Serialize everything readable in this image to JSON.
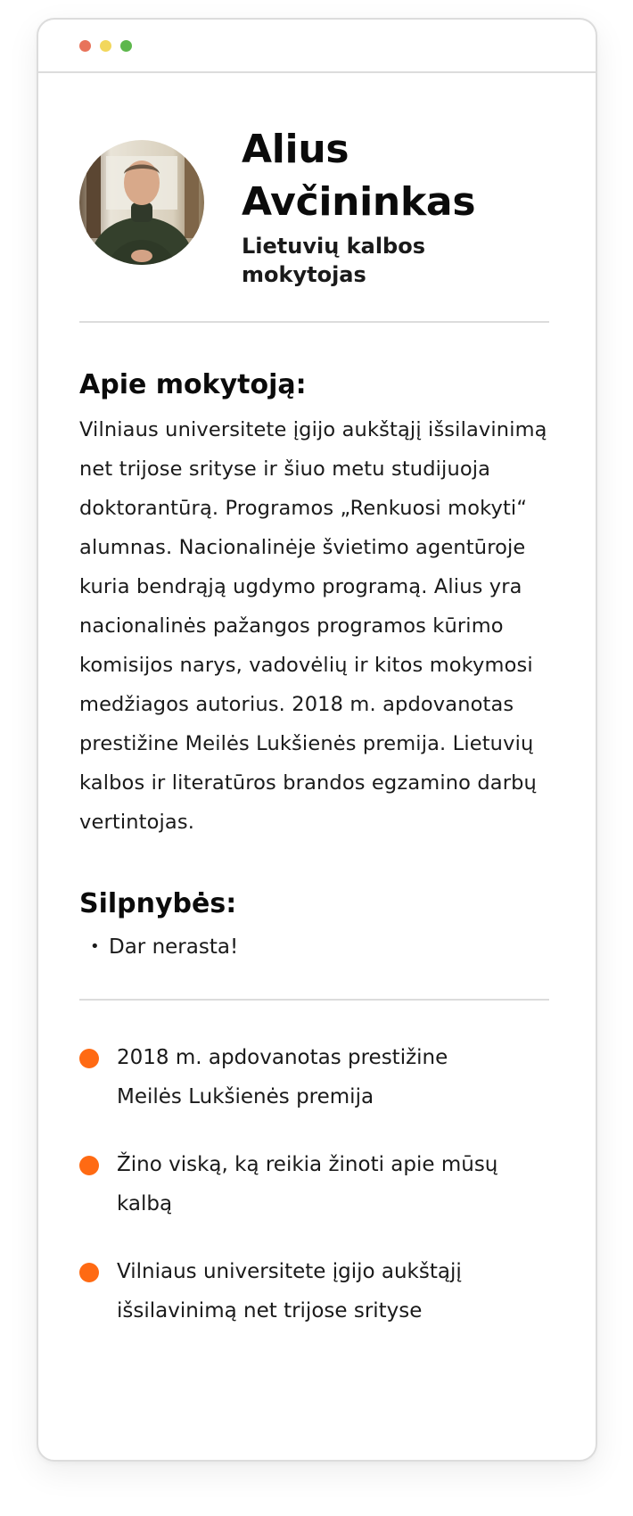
{
  "colors": {
    "accent": "#FF6A13",
    "window_dot_red": "#E8735A",
    "window_dot_yellow": "#F2D75C",
    "window_dot_green": "#5DB74C",
    "divider": "#DCDCDC"
  },
  "profile": {
    "name": "Alius Avčininkas",
    "role": "Lietuvių kalbos mokytojas"
  },
  "about": {
    "title": "Apie mokytoją:",
    "text": "Vilniaus universitete įgijo aukštąjį išsilavinimą net trijose srityse ir šiuo metu studijuoja doktorantūrą. Programos „Renkuosi mokyti“ alumnas. Nacionalinėje švietimo agentūroje kuria bendrąją ugdymo programą. Alius yra nacionalinės pažangos programos kūrimo komisijos narys, vadovėlių ir kitos mokymosi medžiagos autorius. 2018 m. apdovanotas prestižine Meilės Lukšienės premija. Lietuvių kalbos ir literatūros brandos egzamino darbų vertintojas."
  },
  "weaknesses": {
    "title": "Silpnybės:",
    "items": [
      {
        "text": "Dar nerasta!"
      }
    ]
  },
  "highlights": [
    {
      "text": "2018 m. apdovanotas prestižine Meilės Lukšienės premija"
    },
    {
      "text": "Žino viską, ką reikia žinoti apie mūsų kalbą"
    },
    {
      "text": "Vilniaus universitete įgijo aukštąjį išsilavinimą net trijose srityse"
    }
  ]
}
